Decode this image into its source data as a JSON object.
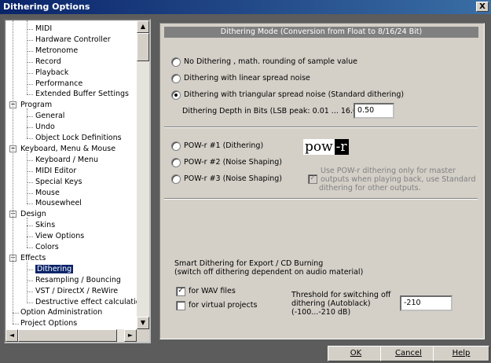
{
  "window": {
    "title": "Dithering Options",
    "close_label": "X"
  },
  "tree": {
    "items": [
      {
        "label": "MIDI",
        "level": 2
      },
      {
        "label": "Hardware Controller",
        "level": 2
      },
      {
        "label": "Metronome",
        "level": 2
      },
      {
        "label": "Record",
        "level": 2
      },
      {
        "label": "Playback",
        "level": 2
      },
      {
        "label": "Performance",
        "level": 2
      },
      {
        "label": "Extended Buffer Settings",
        "level": 2
      },
      {
        "label": "Program",
        "level": 1,
        "expander": "−"
      },
      {
        "label": "General",
        "level": 2
      },
      {
        "label": "Undo",
        "level": 2
      },
      {
        "label": "Object Lock Definitions",
        "level": 2
      },
      {
        "label": "Keyboard, Menu & Mouse",
        "level": 1,
        "expander": "−"
      },
      {
        "label": "Keyboard / Menu",
        "level": 2
      },
      {
        "label": "MIDI Editor",
        "level": 2
      },
      {
        "label": "Special Keys",
        "level": 2
      },
      {
        "label": "Mouse",
        "level": 2
      },
      {
        "label": "Mousewheel",
        "level": 2
      },
      {
        "label": "Design",
        "level": 1,
        "expander": "−"
      },
      {
        "label": "Skins",
        "level": 2
      },
      {
        "label": "View Options",
        "level": 2
      },
      {
        "label": "Colors",
        "level": 2
      },
      {
        "label": "Effects",
        "level": 1,
        "expander": "−"
      },
      {
        "label": "Dithering",
        "level": 2,
        "selected": true
      },
      {
        "label": "Resampling / Bouncing",
        "level": 2
      },
      {
        "label": "VST / DirectX / ReWire",
        "level": 2
      },
      {
        "label": "Destructive effect calculation",
        "level": 2
      },
      {
        "label": "Option Administration",
        "level": 1
      },
      {
        "label": "Project Options",
        "level": 1
      }
    ]
  },
  "panel": {
    "header": "Dithering Mode (Conversion from Float to 8/16/24 Bit)",
    "modes": [
      {
        "label": "No Dithering , math. rounding of sample value",
        "checked": false
      },
      {
        "label": "Dithering with linear spread noise",
        "checked": false
      },
      {
        "label": "Dithering with triangular spread noise (Standard dithering)",
        "checked": true
      }
    ],
    "depth_label": "Dithering Depth in Bits (LSB peak: 0.01 ... 16.0)",
    "depth_value": "0.50",
    "powr_options": [
      {
        "label": "POW-r #1  (Dithering)",
        "checked": false
      },
      {
        "label": "POW-r #2  (Noise Shaping)",
        "checked": false
      },
      {
        "label": "POW-r #3  (Noise Shaping)",
        "checked": false
      }
    ],
    "logo_left": "pow",
    "logo_right": "-r",
    "powr_note": "Use POW-r dithering only for master outputs when playing back, use Standard dithering for other outputs.",
    "smart_title": "Smart Dithering for Export / CD Burning",
    "smart_sub": "(switch off dithering dependent on audio material)",
    "wav_label": "for WAV files",
    "wav_checked": true,
    "virtual_label": "for virtual projects",
    "virtual_checked": false,
    "threshold_label_1": "Threshold for switching off",
    "threshold_label_2": "dithering (Autoblack)",
    "threshold_label_3": "(-100...-210 dB)",
    "threshold_value": "-210"
  },
  "buttons": {
    "ok": "OK",
    "cancel": "Cancel",
    "help": "Help"
  },
  "icons": {
    "scroll_up": "scroll-up-arrow",
    "scroll_down": "scroll-down-arrow",
    "scroll_left": "scroll-left-arrow",
    "scroll_right": "scroll-right-arrow"
  }
}
